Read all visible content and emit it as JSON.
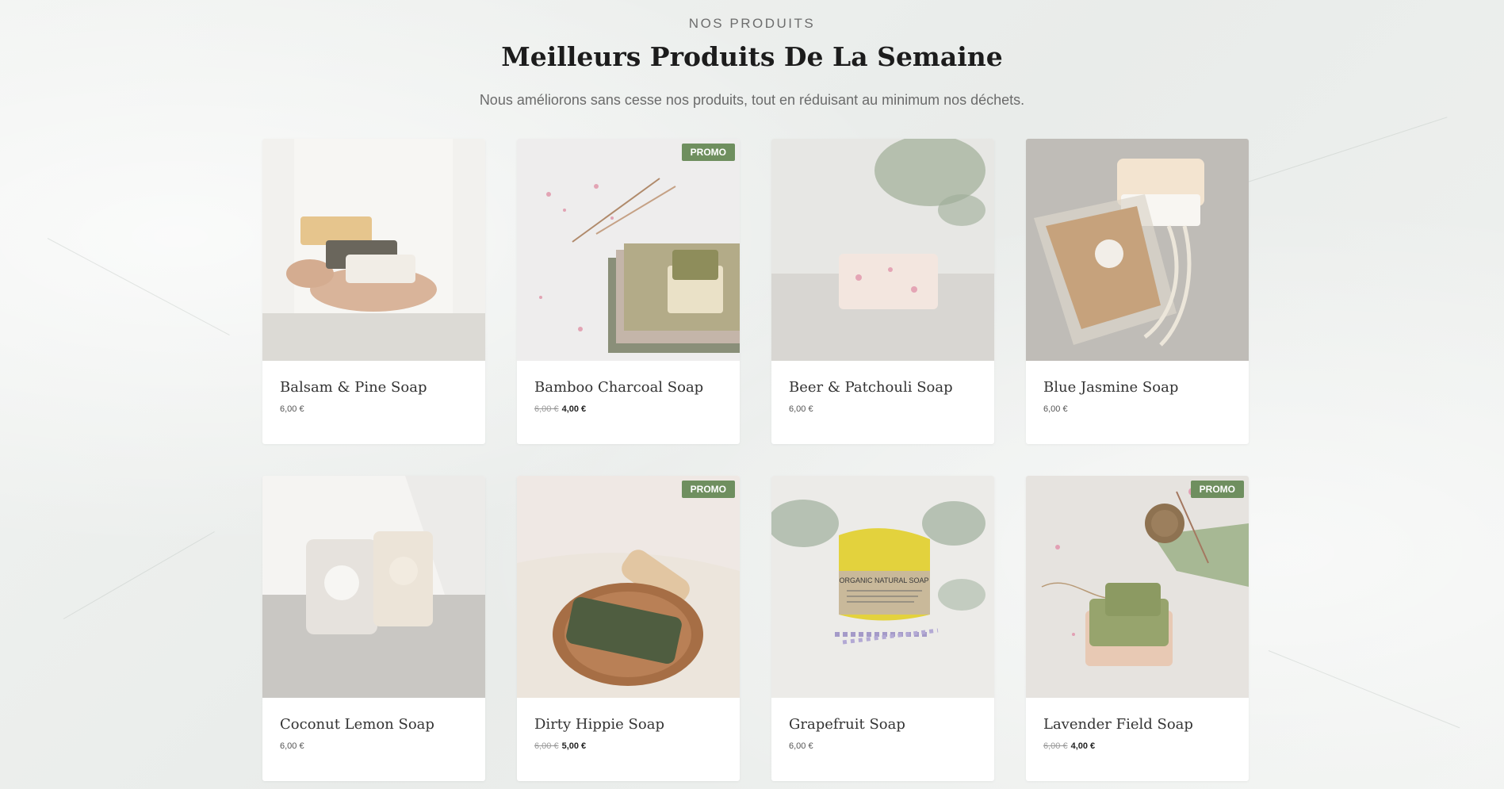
{
  "section": {
    "eyebrow": "NOS PRODUITS",
    "title": "Meilleurs Produits De La Semaine",
    "subtitle": "Nous améliorons sans cesse nos produits, tout en réduisant au minimum nos déchets."
  },
  "badge_label": "PROMO",
  "products": [
    {
      "name": "Balsam & Pine Soap",
      "price": "6,00 €",
      "promo": false,
      "old_price": "",
      "image": "hands-holding-soaps"
    },
    {
      "name": "Bamboo Charcoal Soap",
      "price": "4,00 €",
      "promo": true,
      "old_price": "6,00 €",
      "image": "soap-on-folded-cloth"
    },
    {
      "name": "Beer & Patchouli Soap",
      "price": "6,00 €",
      "promo": false,
      "old_price": "",
      "image": "soap-bar-on-table"
    },
    {
      "name": "Blue Jasmine Soap",
      "price": "6,00 €",
      "promo": false,
      "old_price": "",
      "image": "wrapped-soap-with-rope"
    },
    {
      "name": "Coconut Lemon Soap",
      "price": "6,00 €",
      "promo": false,
      "old_price": "",
      "image": "two-labeled-soaps"
    },
    {
      "name": "Dirty Hippie Soap",
      "price": "5,00 €",
      "promo": true,
      "old_price": "6,00 €",
      "image": "soap-on-wooden-dish"
    },
    {
      "name": "Grapefruit Soap",
      "price": "6,00 €",
      "promo": false,
      "old_price": "",
      "image": "yellow-organic-soap",
      "label_text": "ORGANIC NATURAL SOAP"
    },
    {
      "name": "Lavender Field Soap",
      "price": "4,00 €",
      "promo": true,
      "old_price": "6,00 €",
      "image": "green-soap-with-twine"
    }
  ],
  "colors": {
    "badge": "#6f8f5f",
    "background": "#eef0ee"
  }
}
